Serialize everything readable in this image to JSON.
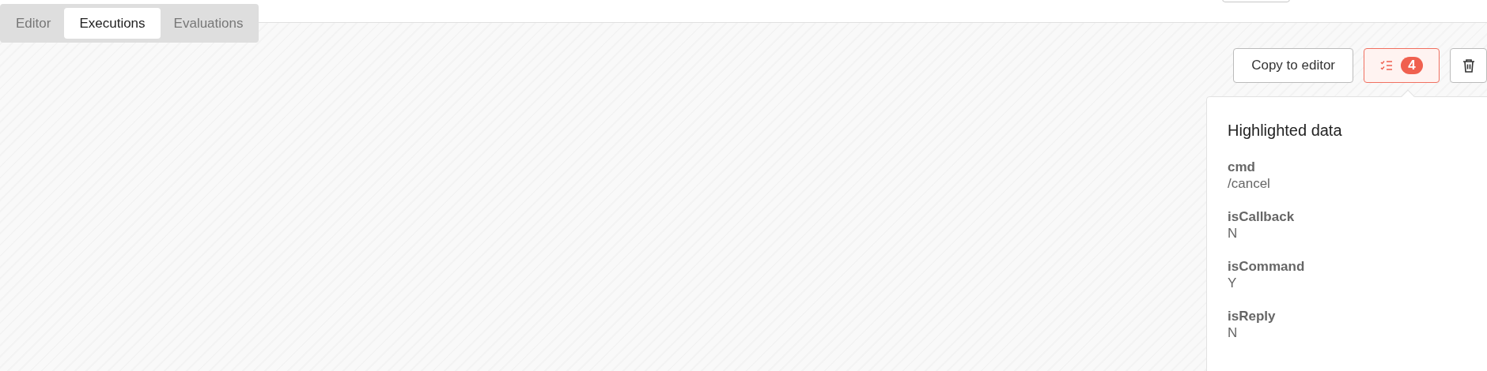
{
  "tabs": [
    {
      "label": "Editor",
      "selected": false
    },
    {
      "label": "Executions",
      "selected": true
    },
    {
      "label": "Evaluations",
      "selected": false
    }
  ],
  "toolbar": {
    "copy_button": "Copy to editor",
    "highlight_count": "4"
  },
  "popover": {
    "title": "Highlighted data",
    "items": [
      {
        "key": "cmd",
        "value": "/cancel"
      },
      {
        "key": "isCallback",
        "value": "N"
      },
      {
        "key": "isCommand",
        "value": "Y"
      },
      {
        "key": "isReply",
        "value": "N"
      }
    ]
  }
}
